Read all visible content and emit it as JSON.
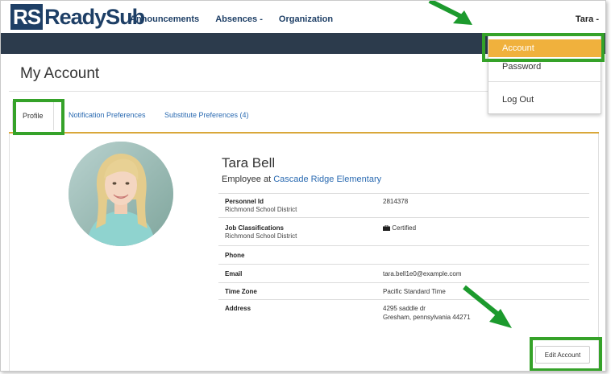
{
  "app": {
    "logo_mark": "RS",
    "logo_text": "ReadySub"
  },
  "nav": {
    "items": [
      "Announcements",
      "Absences -",
      "Organization"
    ],
    "user": "Tara -"
  },
  "dropdown": {
    "items": [
      "Account",
      "Password",
      "Log Out"
    ],
    "active": "Account"
  },
  "page": {
    "title": "My Account"
  },
  "tabs": [
    {
      "label": "Profile",
      "active": true
    },
    {
      "label": "Notification Preferences",
      "active": false
    },
    {
      "label": "Substitute Preferences (4)",
      "active": false
    }
  ],
  "profile": {
    "name": "Tara Bell",
    "employer_prefix": "Employee at ",
    "employer": "Cascade Ridge Elementary",
    "rows": [
      {
        "label": "Personnel Id",
        "sub": "Richmond School District",
        "value": "2814378"
      },
      {
        "label": "Job Classifications",
        "sub": "Richmond School District",
        "value": "Certified",
        "icon": "briefcase-icon"
      },
      {
        "label": "Phone",
        "sub": "",
        "value": ""
      },
      {
        "label": "Email",
        "sub": "",
        "value": "tara.bell1e0@example.com"
      },
      {
        "label": "Time Zone",
        "sub": "",
        "value": "Pacific Standard Time"
      },
      {
        "label": "Address",
        "sub": "",
        "value": "4295 saddle dr",
        "value2": "Gresham, pennsylvania 44271"
      }
    ],
    "edit_label": "Edit Account"
  },
  "colors": {
    "brand": "#1e3f66",
    "accent": "#f0b13d",
    "highlight": "#35a229",
    "bar": "#2c3b4c",
    "link": "#2a6ab1"
  }
}
